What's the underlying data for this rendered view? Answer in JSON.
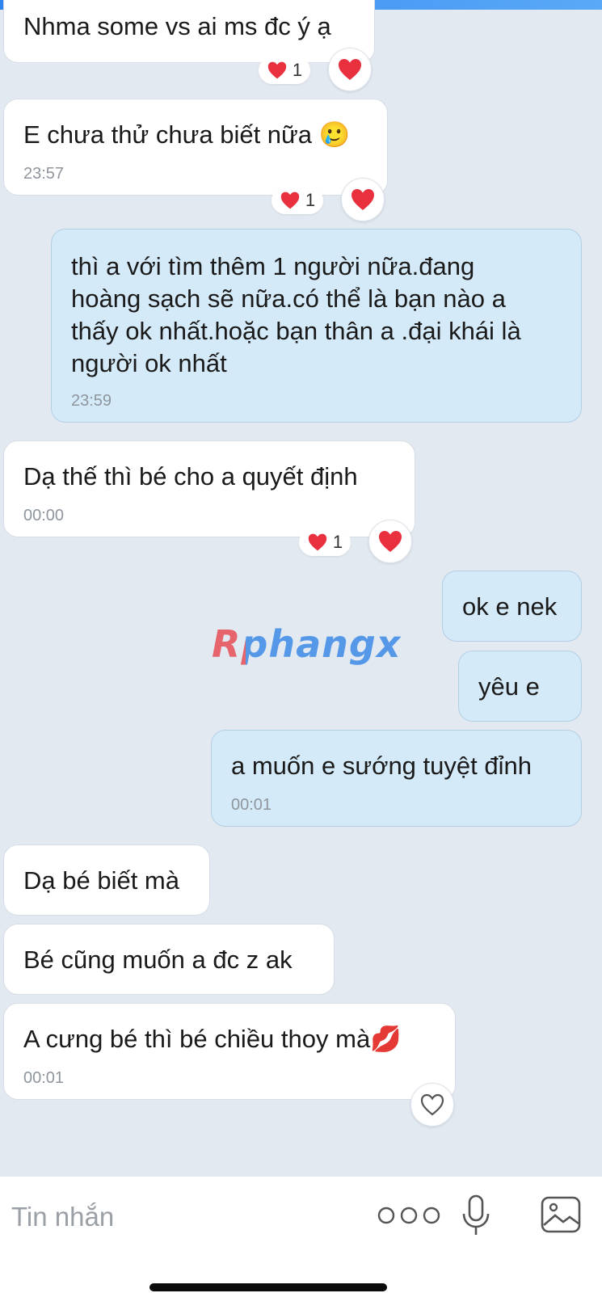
{
  "messages": [
    {
      "text": "Nhma some vs ai ms đc ý ạ"
    },
    {
      "text": "E chưa thử chưa biết nữa 🥲",
      "time": "23:57"
    },
    {
      "lines": [
        "thì a với tìm thêm 1 người nữa.đang",
        "hoàng sạch sẽ nữa.có thể là bạn nào a",
        "thấy ok nhất.hoặc bạn thân a .đại khái là",
        "người ok nhất"
      ],
      "time": "23:59"
    },
    {
      "text": "Dạ thế thì bé cho a quyết định",
      "time": "00:00"
    },
    {
      "text": "ok e nek"
    },
    {
      "text": "yêu e"
    },
    {
      "text": "a muốn e sướng tuyệt đỉnh",
      "time": "00:01"
    },
    {
      "text": "Dạ bé biết mà"
    },
    {
      "text": "Bé cũng muốn a đc z ak"
    },
    {
      "text": "A cưng bé thì bé chiều thoy mà💋",
      "time": "00:01"
    }
  ],
  "reaction_count": "1",
  "watermark": "Rphangx",
  "composer": {
    "placeholder": "Tin nhắn"
  },
  "colors": {
    "incoming": "#ffffff",
    "outgoing": "#d5eaf8",
    "background": "#e2e9f1",
    "heart": "#e8303e"
  },
  "icons": [
    "heart-icon",
    "heart-outline-icon",
    "more-icon",
    "microphone-icon",
    "image-icon"
  ]
}
